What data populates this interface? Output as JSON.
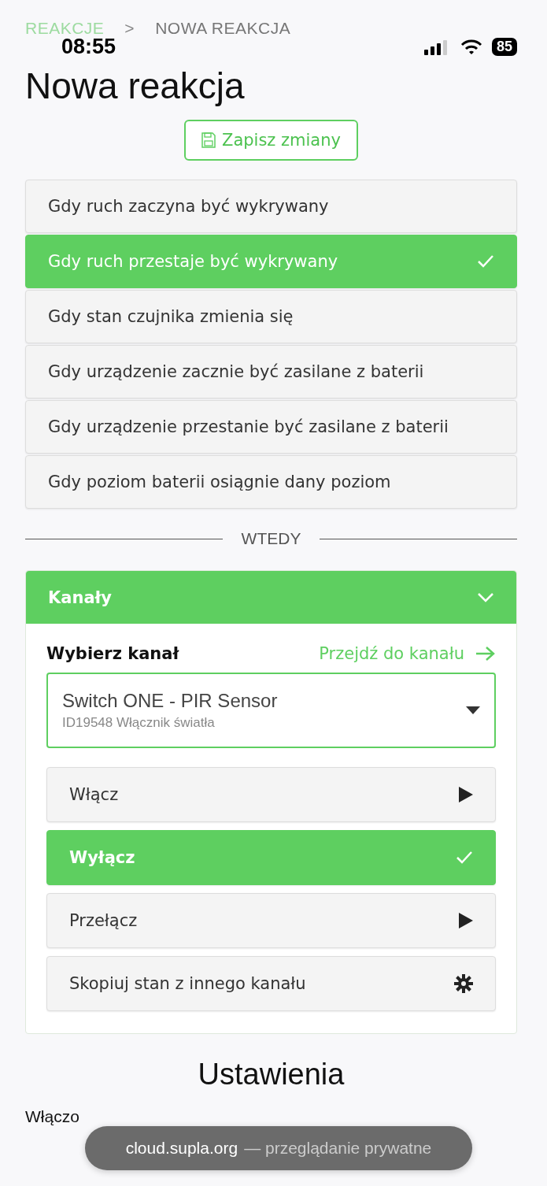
{
  "status_bar": {
    "time": "08:55",
    "battery": "85"
  },
  "breadcrumb": [
    {
      "label": "REAKCJE",
      "kind": "link"
    },
    {
      "label": ">",
      "kind": "separator"
    },
    {
      "label": "NOWA REAKCJA",
      "kind": "current"
    }
  ],
  "title": "Nowa reakcja",
  "save_button": {
    "label": "Zapisz zmiany"
  },
  "triggers": [
    {
      "label": "Gdy ruch zaczyna być wykrywany",
      "selected": false
    },
    {
      "label": "Gdy ruch przestaje być wykrywany",
      "selected": true
    },
    {
      "label": "Gdy stan czujnika zmienia się",
      "selected": false
    },
    {
      "label": "Gdy urządzenie zacznie być zasilane z baterii",
      "selected": false
    },
    {
      "label": "Gdy urządzenie przestanie być zasilane z baterii",
      "selected": false
    },
    {
      "label": "Gdy poziom baterii osiągnie dany poziom",
      "selected": false
    }
  ],
  "divider_label": "WTEDY",
  "channels_panel": {
    "title": "Kanały",
    "expanded": true,
    "select_label": "Wybierz kanał",
    "goto_link": "Przejdź do kanału",
    "channel": {
      "name": "Switch ONE - PIR Sensor",
      "subtitle": "ID19548 Włącznik światła"
    },
    "actions": [
      {
        "label": "Włącz",
        "selected": false,
        "kind": "run"
      },
      {
        "label": "Wyłącz",
        "selected": true
      },
      {
        "label": "Przełącz",
        "selected": false,
        "kind": "run"
      },
      {
        "label": "Skopiuj stan z innego kanału",
        "selected": false,
        "kind": "copy"
      }
    ]
  },
  "settings": {
    "title": "Ustawienia",
    "enabled_label": "Włączo"
  },
  "browser_toast": {
    "domain": "cloud.supla.org",
    "text": "— przeglądanie prywatne"
  }
}
